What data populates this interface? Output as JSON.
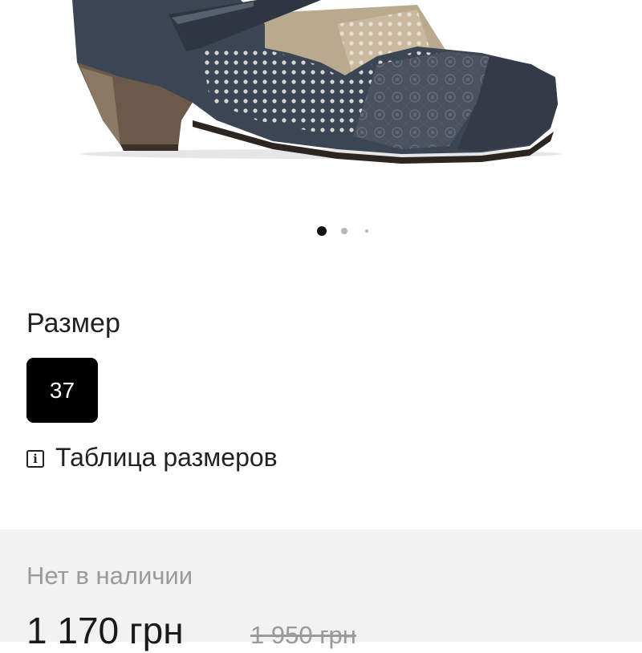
{
  "gallery": {
    "image_alt": "shoe-photo",
    "active_slide": 1,
    "slide_count": 3
  },
  "size": {
    "label": "Размер",
    "options": [
      "37"
    ],
    "selected": "37",
    "table_link": "Таблица размеров"
  },
  "purchase": {
    "stock_status": "Нет в наличии",
    "price": "1 170 грн",
    "old_price": "1 950 грн"
  },
  "colors": {
    "accent": "#000000",
    "panel_bg": "#f2f2f2",
    "muted_text": "#9a9a9a"
  }
}
